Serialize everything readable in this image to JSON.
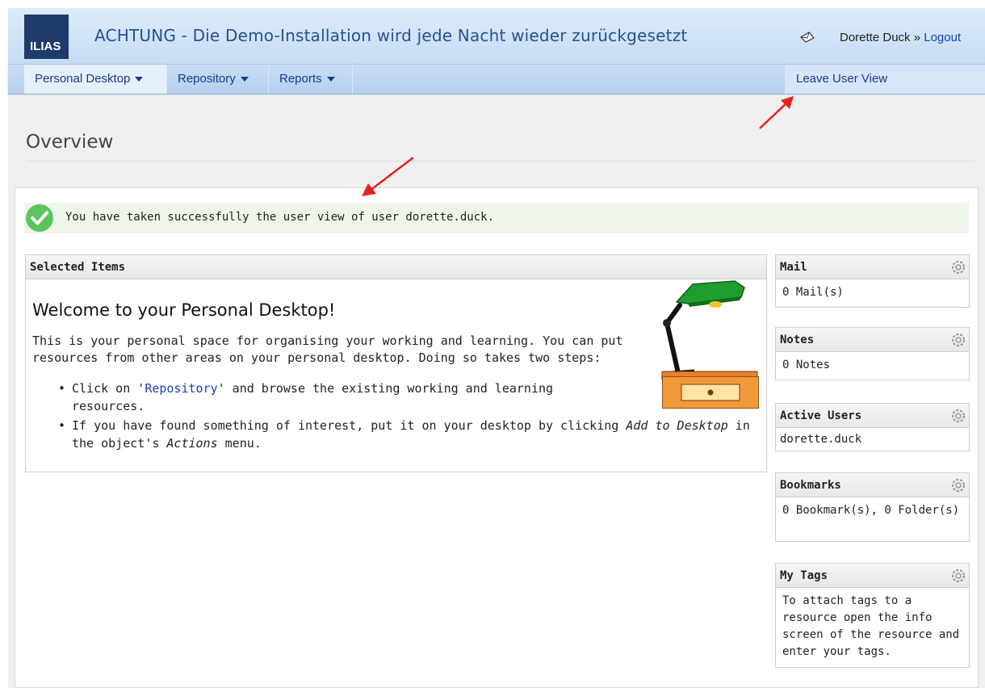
{
  "header": {
    "logo_text": "ILIAS",
    "title": "ACHTUNG - Die Demo-Installation wird jede Nacht wieder zurückgesetzt",
    "user_name": "Dorette Duck",
    "separator": " » ",
    "logout_label": "Logout"
  },
  "nav": {
    "items": [
      {
        "label": "Personal Desktop"
      },
      {
        "label": "Repository"
      },
      {
        "label": "Reports"
      }
    ],
    "leave_user_view": "Leave User View"
  },
  "page": {
    "title": "Overview",
    "success_message": "You have taken successfully the user view of user dorette.duck."
  },
  "selected_items": {
    "heading": "Selected Items",
    "welcome_title": "Welcome to your Personal Desktop!",
    "intro": "This is your personal space for organising your working and learning. You can put resources from other areas on your personal desktop. Doing so takes two steps:",
    "bullet_glyph": "•",
    "step1_prefix": "Click on '",
    "step1_link": "Repository",
    "step1_suffix": "' and browse the existing working and learning resources.",
    "step2_prefix": "If you have found something of interest, put it on your desktop by clicking ",
    "step2_italic1": "Add to Desktop",
    "step2_middle": " in the object's ",
    "step2_italic2": "Actions",
    "step2_suffix": " menu."
  },
  "side_blocks": {
    "mail": {
      "title": "Mail",
      "body": "0 Mail(s)"
    },
    "notes": {
      "title": "Notes",
      "body": "0 Notes"
    },
    "active_users": {
      "title": "Active Users",
      "body": "dorette.duck"
    },
    "bookmarks": {
      "title": "Bookmarks",
      "body": "0 Bookmark(s), 0 Folder(s)"
    },
    "my_tags": {
      "title": "My Tags",
      "body": "To attach tags to a resource open the info screen of the resource and enter your tags."
    }
  },
  "colors": {
    "header_title": "#2a4f8f",
    "nav_text": "#1a3a8a",
    "link": "#1a3fb0",
    "success_bg": "#eef6ea",
    "success_icon": "#5cc45c",
    "annotation_arrow": "#e8201e"
  }
}
